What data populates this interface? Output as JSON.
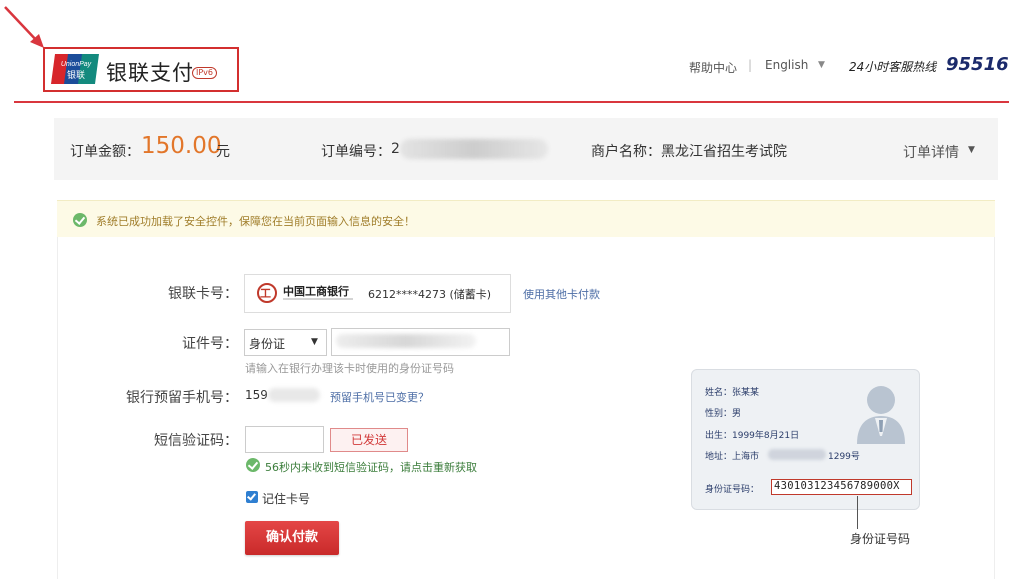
{
  "header": {
    "logo_text": "UnionPay 银联",
    "brand": "银联支付",
    "ipv6_badge": "IPv6",
    "help_link": "帮助中心",
    "separator": "|",
    "language": "English",
    "hotline_label": "24小时客服热线",
    "hotline": "95516"
  },
  "order": {
    "amount_label": "订单金额：",
    "amount": "150.00",
    "amount_unit": "元",
    "order_no_label": "订单编号：",
    "order_no_visible": "2",
    "merchant": "商户名称：黑龙江省招生考试院",
    "detail_link": "订单详情"
  },
  "notice": {
    "text": "系统已成功加载了安全控件，保障您在当前页面输入信息的安全！"
  },
  "form": {
    "card_label": "银联卡号：",
    "bank_name": "中国工商银行",
    "card_number": "6212****4273 (储蓄卡)",
    "other_card_link": "使用其他卡付款",
    "id_label": "证件号：",
    "id_type": "身份证",
    "id_hint": "请输入在银行办理该卡时使用的身份证号码",
    "phone_label": "银行预留手机号：",
    "phone_visible": "159",
    "phone_changed_link": "预留手机号已变更？",
    "sms_label": "短信验证码：",
    "sms_sent_button": "已发送",
    "sms_tip": "56秒内未收到短信验证码，请点击重新获取",
    "remember_label": "记住卡号",
    "remember_checked": true,
    "confirm_button": "确认付款"
  },
  "id_card": {
    "name": "姓名：张某某",
    "gender": "性别：男",
    "birth": "出生：1999年8月21日",
    "address_prefix": "地址：上海市",
    "address_suffix": "1299号",
    "id_label": "身份证号码：",
    "id_number": "430103123456789000X",
    "caption": "身份证号码"
  },
  "colors": {
    "brand_red": "#d9363e",
    "amount_orange": "#e2762a",
    "link_blue": "#4d6ea6",
    "hotline_navy": "#1b2a6b"
  }
}
